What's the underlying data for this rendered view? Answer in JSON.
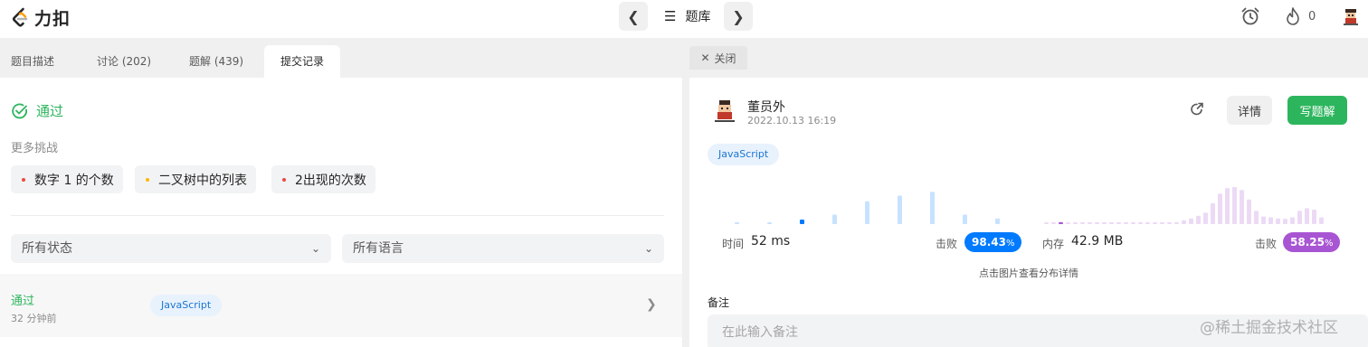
{
  "app": {
    "logo_text": "力扣",
    "problem_list_label": "题库",
    "streak_count": "0",
    "brand_color": "#ffa116"
  },
  "left": {
    "tabs": [
      {
        "label": "题目描述"
      },
      {
        "label": "讨论 (202)"
      },
      {
        "label": "题解 (439)"
      },
      {
        "label": "提交记录"
      }
    ],
    "result_label": "通过",
    "more_challenges_title": "更多挑战",
    "challenges": [
      {
        "label": "数字 1 的个数",
        "dot_color": "#ef4743"
      },
      {
        "label": "二叉树中的列表",
        "dot_color": "#ffb800"
      },
      {
        "label": "2出现的次数",
        "dot_color": "#ef4743"
      }
    ],
    "status_filter": "所有状态",
    "language_filter": "所有语言",
    "submission": {
      "status": "通过",
      "time": "32 分钟前",
      "language": "JavaScript"
    }
  },
  "right": {
    "close_tab_label": "关闭",
    "user_name": "董员外",
    "submit_time": "2022.10.13 16:19",
    "detail_label": "详情",
    "write_solution_label": "写题解",
    "language": "JavaScript",
    "runtime": {
      "label": "时间",
      "value": "52 ms",
      "beat_label": "击败",
      "beat_value": "98.43",
      "beat_unit": "%",
      "color": "#007aff",
      "hist_levels": [
        0.05,
        0.05,
        0.12,
        0.25,
        0.6,
        0.75,
        0.85,
        0.25,
        0.15
      ],
      "selected_index": 2
    },
    "memory": {
      "label": "内存",
      "value": "42.9 MB",
      "beat_label": "击败",
      "beat_value": "58.25",
      "beat_unit": "%",
      "color": "#a855d3",
      "hist_levels": [
        0.03,
        0.03,
        0.05,
        0.04,
        0.04,
        0.04,
        0.04,
        0.04,
        0.04,
        0.04,
        0.04,
        0.04,
        0.04,
        0.04,
        0.04,
        0.04,
        0.04,
        0.04,
        0.05,
        0.1,
        0.15,
        0.22,
        0.3,
        0.55,
        0.8,
        0.95,
        0.98,
        0.9,
        0.65,
        0.35,
        0.2,
        0.18,
        0.15,
        0.14,
        0.18,
        0.35,
        0.42,
        0.38,
        0.18
      ],
      "selected_index": 2
    },
    "distribution_hint": "点击图片查看分布详情",
    "note_label": "备注",
    "note_placeholder": "在此输入备注"
  },
  "watermark": "@稀土掘金技术社区"
}
